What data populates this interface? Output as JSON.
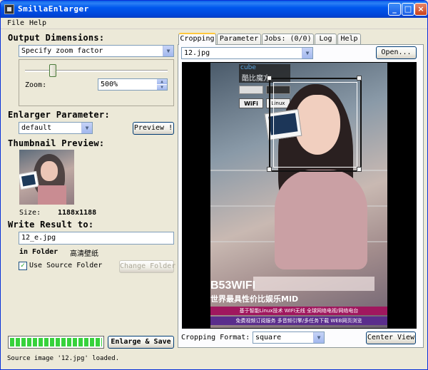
{
  "window": {
    "title": "SmillaEnlarger"
  },
  "menu": {
    "file": "File",
    "help": "Help"
  },
  "output": {
    "heading": "Output Dimensions:",
    "mode": "Specify zoom factor",
    "zoom_label": "Zoom:",
    "zoom_value": "500%",
    "zoom_slider_fraction": 0.18
  },
  "enlarger": {
    "heading": "Enlarger Parameter:",
    "preset": "default",
    "preview_button": "Preview !"
  },
  "thumbnail": {
    "heading": "Thumbnail Preview:",
    "size_label": "Size:",
    "size_value": "1188x1188"
  },
  "write": {
    "heading": "Write Result to:",
    "filename": "12_e.jpg",
    "in_folder_label": "in Folder",
    "folder_name": "高清壁纸",
    "use_source_folder_label": "Use Source Folder",
    "use_source_folder_checked": true,
    "change_folder_button": "Change Folder"
  },
  "progress": {
    "fraction": 1.0
  },
  "enlarge_button": "Enlarge & Save",
  "status": "Source image '12.jpg' loaded.",
  "tabs": [
    {
      "label": "Cropping",
      "active": true
    },
    {
      "label": "Parameter",
      "active": false
    },
    {
      "label": "Jobs: (0/0)",
      "active": false
    },
    {
      "label": "Log",
      "active": false
    },
    {
      "label": "Help",
      "active": false
    }
  ],
  "cropping": {
    "source_file": "12.jpg",
    "open_button": "Open...",
    "format_label": "Cropping Format:",
    "format_value": "square",
    "center_view_button": "Center View"
  },
  "photo_texts": {
    "brand": "B53WIFI",
    "tagline": "世界最具性价比娱乐MID",
    "line1": "基于智能Linux技术  WIFI无线  全球网络电视/网络电台",
    "line2": "免费视频订阅服务 多音频引擎/多任务下载 WEB网页浏览",
    "wifi_badge": "WiFi",
    "linux_badge": "Linux",
    "cube_label": "cube",
    "cube_cn": "酷比魔方"
  },
  "colors": {
    "titlebar": "#0055e5",
    "tab_highlight": "#ffc83c",
    "progress": "#37d23c",
    "photo_banner_1": "#a0175e",
    "photo_banner_2": "#5a2d8c"
  }
}
